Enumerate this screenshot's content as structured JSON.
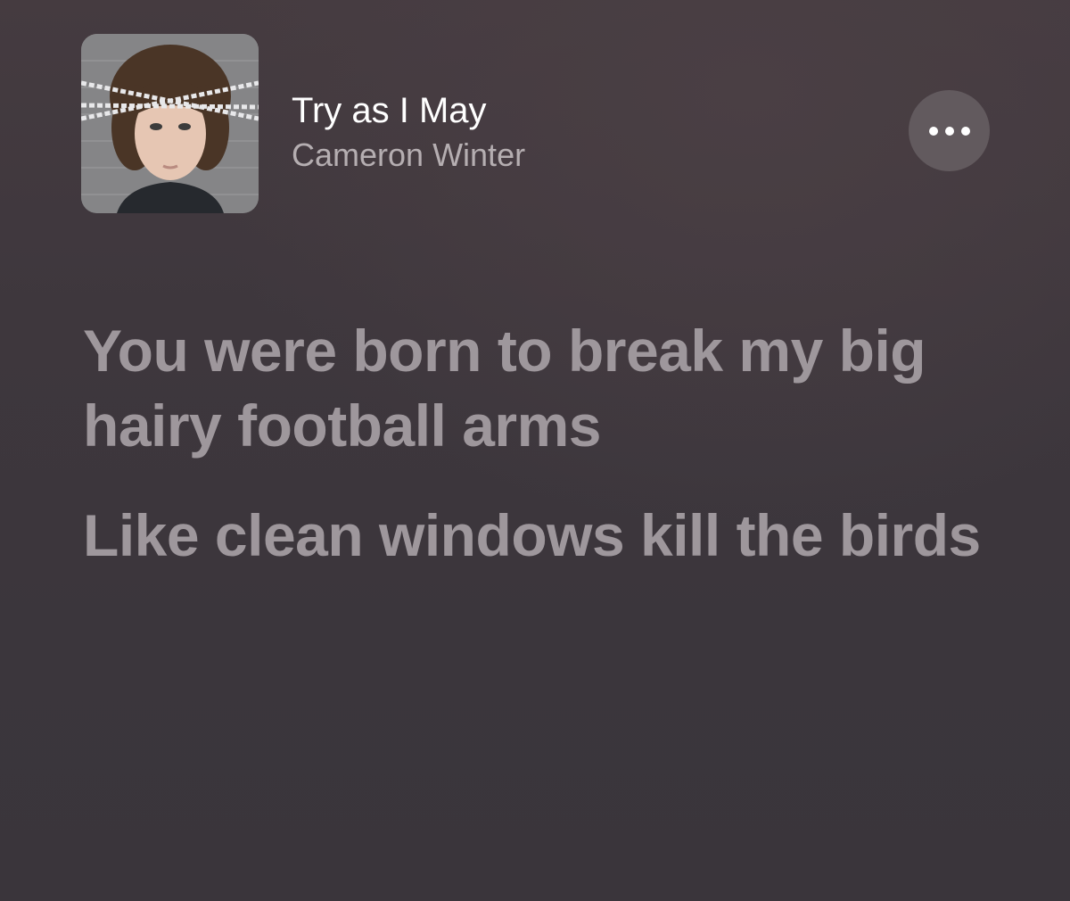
{
  "now_playing": {
    "title": "Try as I May",
    "artist": "Cameron Winter",
    "more_icon": "ellipsis-icon"
  },
  "lyrics": [
    "You were born to break my big hairy football arms",
    "Like clean windows kill the birds"
  ],
  "colors": {
    "background": "#3e373d",
    "title": "#ffffff",
    "artist": "#b5aeb1",
    "lyric_text": "#9e979c",
    "more_button_bg": "#625a5e"
  }
}
